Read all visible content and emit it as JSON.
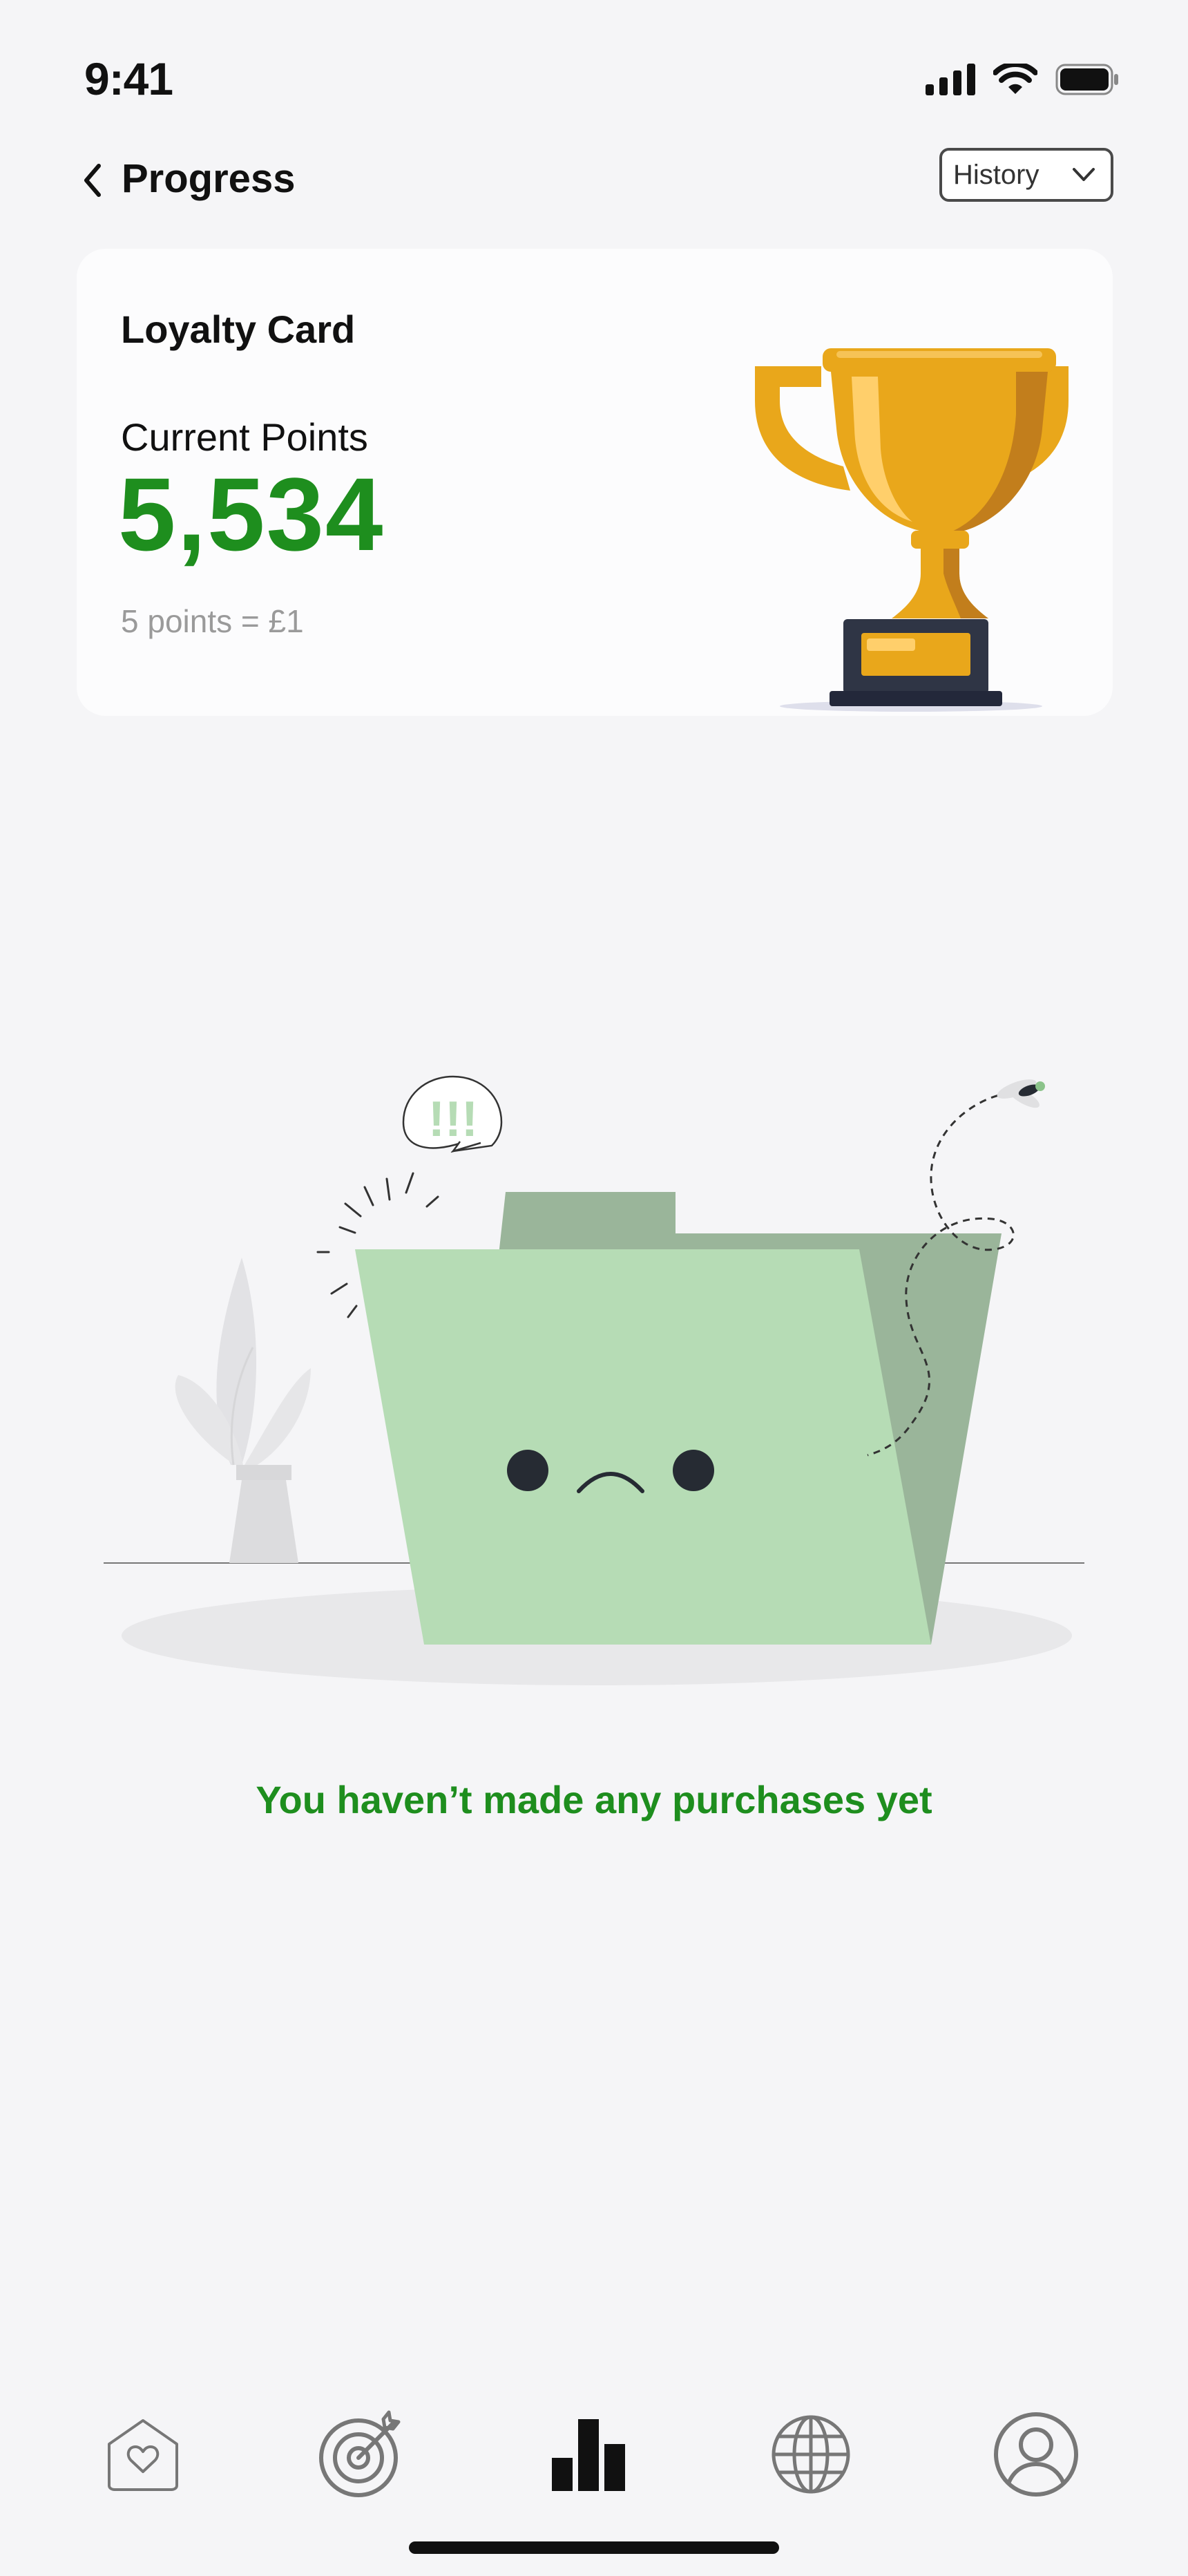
{
  "status_bar": {
    "time": "9:41",
    "icons": [
      "signal-icon",
      "wifi-icon",
      "battery-icon"
    ]
  },
  "header": {
    "back_icon": "chevron-left-icon",
    "title": "Progress",
    "history_label": "History",
    "history_icon": "chevron-down-icon"
  },
  "loyalty_card": {
    "title": "Loyalty Card",
    "points_label": "Current Points",
    "points_value": "5,534",
    "conversion": "5 points = £1",
    "image": "trophy-icon"
  },
  "empty_state": {
    "image": "empty-folder-illustration",
    "bubble_text": "!!!",
    "message": "You haven’t made any purchases yet"
  },
  "tab_bar": {
    "items": [
      {
        "icon": "home-heart-icon",
        "active": false
      },
      {
        "icon": "target-icon",
        "active": false
      },
      {
        "icon": "bar-chart-icon",
        "active": true
      },
      {
        "icon": "globe-icon",
        "active": false
      },
      {
        "icon": "profile-icon",
        "active": false
      }
    ]
  },
  "colors": {
    "accent_green": "#1E8E1E",
    "background": "#F5F5F7",
    "folder_front": "#B6DCB5",
    "folder_back": "#9AB59A",
    "trophy_gold": "#E9A71B"
  }
}
